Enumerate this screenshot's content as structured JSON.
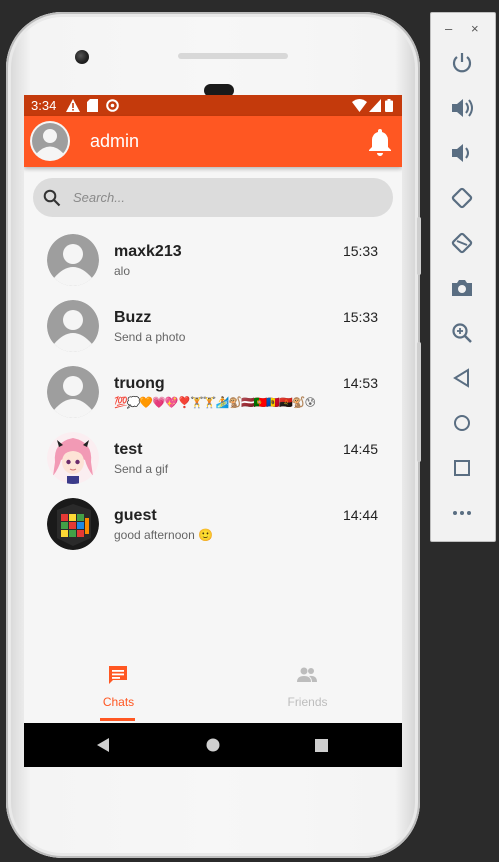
{
  "status_bar": {
    "time": "3:34"
  },
  "app_bar": {
    "title": "admin"
  },
  "search": {
    "placeholder": "Search..."
  },
  "chats": [
    {
      "name": "maxk213",
      "time": "15:33",
      "message": "alo",
      "avatar": "default-avatar"
    },
    {
      "name": "Buzz",
      "time": "15:33",
      "message": "Send a photo",
      "avatar": "default-avatar"
    },
    {
      "name": "truong",
      "time": "14:53",
      "message": "💯💭🧡💗💖❣️🏋️🏋️🏄🐒🇱🇻🇵🇹🇲🇩🇦🇴🐒😰",
      "avatar": "default-avatar"
    },
    {
      "name": "test",
      "time": "14:45",
      "message": "Send a gif",
      "avatar": "anime-avatar"
    },
    {
      "name": "guest",
      "time": "14:44",
      "message": "good afternoon 🙂",
      "avatar": "cube-avatar"
    }
  ],
  "bottom_nav": [
    {
      "label": "Chats",
      "icon": "chat-icon",
      "active": true
    },
    {
      "label": "Friends",
      "icon": "people-icon",
      "active": false
    }
  ],
  "colors": {
    "accent": "#ff5722",
    "status_bar": "#c43a0c",
    "inactive": "#bdbdbd"
  }
}
